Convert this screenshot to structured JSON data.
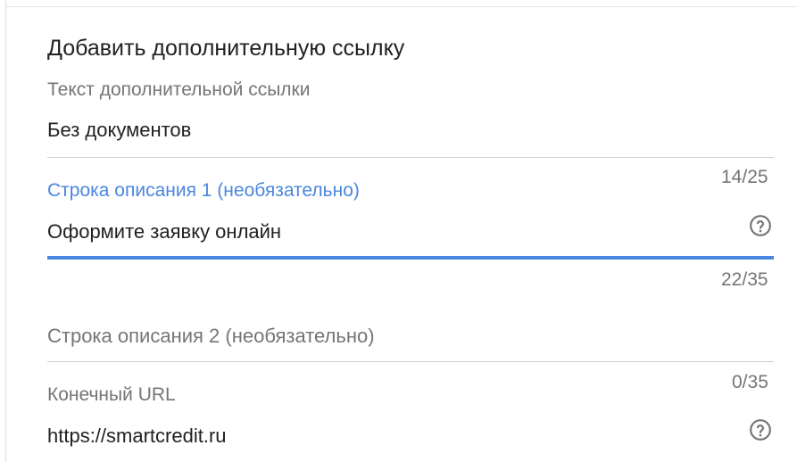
{
  "form": {
    "title": "Добавить дополнительную ссылку",
    "link_text": {
      "label": "Текст дополнительной ссылки",
      "value": "Без документов",
      "counter": "14/25"
    },
    "description_1": {
      "label": "Строка описания 1 (необязательно)",
      "value": "Оформите заявку онлайн",
      "counter": "22/35",
      "help_icon": "question-circle-icon"
    },
    "description_2": {
      "label": "Строка описания 2 (необязательно)",
      "value": "",
      "counter": "0/35"
    },
    "final_url": {
      "label": "Конечный URL",
      "value": "https://smartcredit.ru",
      "help_icon": "question-circle-icon"
    }
  },
  "colors": {
    "accent": "#4a86e0",
    "label": "#757575",
    "text": "#202124",
    "divider": "#cfcfcf"
  }
}
